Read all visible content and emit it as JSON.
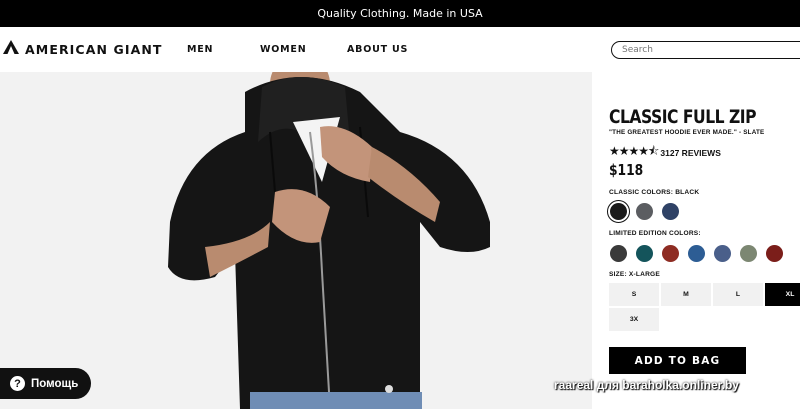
{
  "banner": {
    "text": "Quality Clothing. Made in USA"
  },
  "nav": {
    "logo_text": "AMERICAN GIANT",
    "links": [
      "MEN",
      "WOMEN",
      "ABOUT US"
    ],
    "search_placeholder": "Search"
  },
  "product": {
    "name": "CLASSIC FULL ZIP",
    "subtitle": "\"THE GREATEST HOODIE EVER MADE.\" - SLATE",
    "stars": "★★★★⯪",
    "reviews": "3127 REVIEWS",
    "price": "$118",
    "classic_colors_label": "CLASSIC COLORS: BLACK",
    "classic_colors": [
      "#1a1a1a",
      "#5b5d61",
      "#2f4266"
    ],
    "limited_label": "LIMITED EDITION COLORS:",
    "limited_colors": [
      "#3a3a3a",
      "#14545b",
      "#8e2c23",
      "#2d5d94",
      "#4a5f8a",
      "#7c8772",
      "#7b1e1a"
    ],
    "size_label": "SIZE: X-LARGE",
    "sizes": [
      "S",
      "M",
      "L",
      "XL",
      "3X"
    ],
    "selected_size": "XL",
    "add_to_bag": "ADD TO BAG"
  },
  "help": {
    "label": "Помощь",
    "icon": "question-icon"
  },
  "watermark": "raareal для baraholka.onliner.by"
}
